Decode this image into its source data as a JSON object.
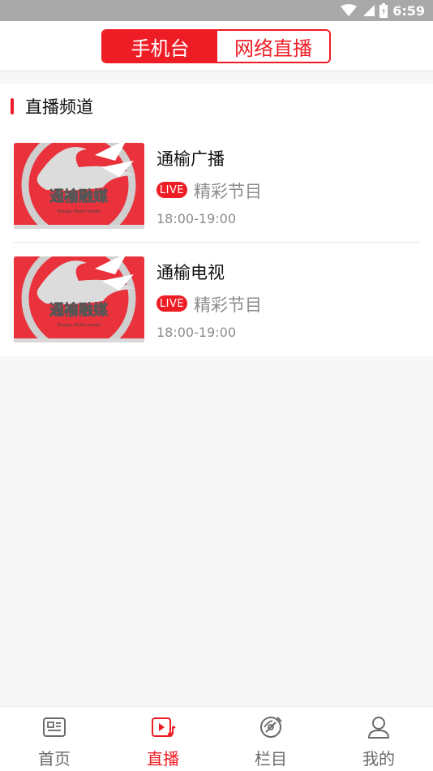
{
  "status_bar": {
    "time": "6:59",
    "icons": [
      "wifi-icon",
      "cellular-signal-icon",
      "battery-icon"
    ]
  },
  "header": {
    "tabs": [
      {
        "label": "手机台",
        "active": true
      },
      {
        "label": "网络直播",
        "active": false
      }
    ]
  },
  "section": {
    "title": "直播频道"
  },
  "channels": [
    {
      "name": "通榆广播",
      "live_badge": "LIVE",
      "program": "精彩节目",
      "time": "18:00-19:00",
      "thumbnail_logo_text": "通榆融媒",
      "thumbnail_logo_subtext": "Tongyu Multi media"
    },
    {
      "name": "通榆电视",
      "live_badge": "LIVE",
      "program": "精彩节目",
      "time": "18:00-19:00",
      "thumbnail_logo_text": "通榆融媒",
      "thumbnail_logo_subtext": "Tongyu Multi media"
    }
  ],
  "tab_bar": {
    "items": [
      {
        "label": "首页",
        "icon": "news-icon",
        "active": false
      },
      {
        "label": "直播",
        "icon": "live-video-icon",
        "active": true
      },
      {
        "label": "栏目",
        "icon": "column-icon",
        "active": false
      },
      {
        "label": "我的",
        "icon": "profile-icon",
        "active": false
      }
    ]
  },
  "colors": {
    "accent": "#ee1c25",
    "status_bar": "#a9a9a9",
    "muted_text": "#8c8c8c",
    "inactive_tab": "#6a6a6a",
    "page_background": "#f7f7f7"
  }
}
